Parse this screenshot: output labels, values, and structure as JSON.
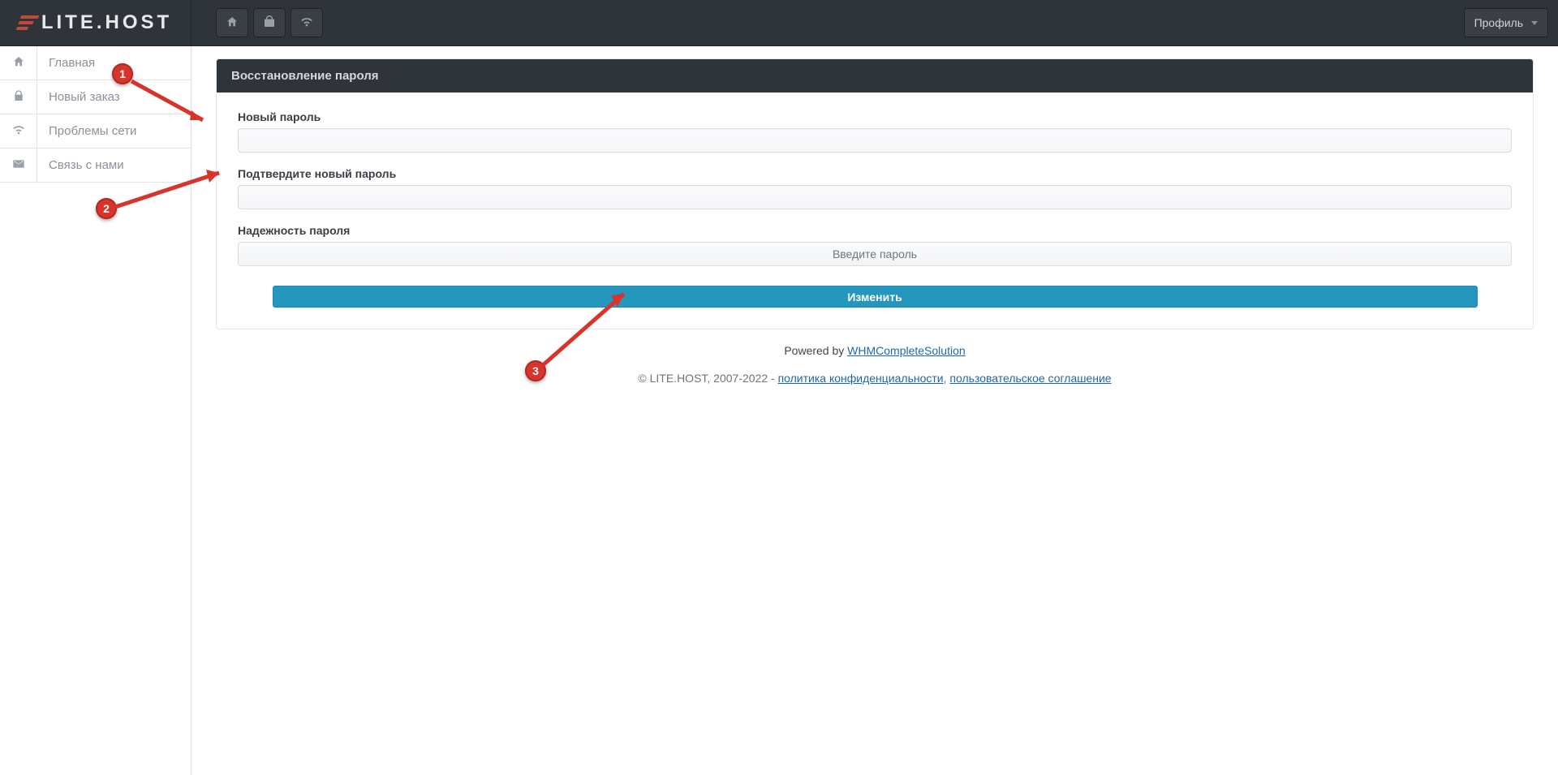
{
  "header": {
    "logo_text": "LITE.HOST",
    "toolbar": {
      "home_title": "home",
      "shop_title": "shop",
      "wifi_title": "network"
    },
    "profile_label": "Профиль"
  },
  "sidebar": {
    "items": [
      {
        "id": "home",
        "label": "Главная"
      },
      {
        "id": "order",
        "label": "Новый заказ"
      },
      {
        "id": "network",
        "label": "Проблемы сети"
      },
      {
        "id": "contact",
        "label": "Связь с нами"
      }
    ]
  },
  "panel": {
    "title": "Восстановление пароля",
    "new_password_label": "Новый пароль",
    "confirm_password_label": "Подтвердите новый пароль",
    "strength_label": "Надежность пароля",
    "strength_placeholder": "Введите пароль",
    "submit_label": "Изменить"
  },
  "footer": {
    "powered_prefix": "Powered by ",
    "powered_link": "WHMCompleteSolution",
    "copyright_prefix": "© LITE.HOST, 2007-2022 - ",
    "privacy_link": "политика конфиденциальности",
    "separator": ", ",
    "tos_link": "пользовательское соглашение"
  },
  "annotations": {
    "badge1": "1",
    "badge2": "2",
    "badge3": "3"
  }
}
